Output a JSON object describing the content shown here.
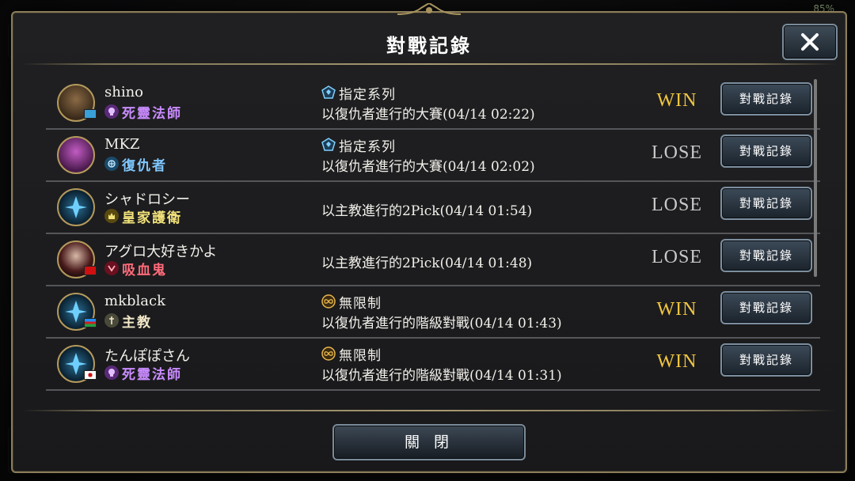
{
  "status": {
    "battery": "85%"
  },
  "dialog": {
    "title": "對戰記錄",
    "close_label": "關 閉",
    "row_button_label": "對戰記錄"
  },
  "rows": [
    {
      "name": "shino",
      "class": "死靈法師",
      "class_color": "#c98bff",
      "mode": "指定系列",
      "desc": "以復仇者進行的大賽(04/14 02:22)",
      "result": "WIN"
    },
    {
      "name": "MKZ",
      "class": "復仇者",
      "class_color": "#7fc8ff",
      "mode": "指定系列",
      "desc": "以復仇者進行的大賽(04/14 02:02)",
      "result": "LOSE"
    },
    {
      "name": "シャドロシー",
      "class": "皇家護衛",
      "class_color": "#f2e27a",
      "mode": "",
      "desc": "以主教進行的2Pick(04/14 01:54)",
      "result": "LOSE"
    },
    {
      "name": "アグロ大好きかよ",
      "class": "吸血鬼",
      "class_color": "#ff6a7a",
      "mode": "",
      "desc": "以主教進行的2Pick(04/14 01:48)",
      "result": "LOSE"
    },
    {
      "name": "mkblack",
      "class": "主教",
      "class_color": "#f2e8c8",
      "mode": "無限制",
      "desc": "以復仇者進行的階級對戰(04/14 01:43)",
      "result": "WIN"
    },
    {
      "name": "たんぽぽさん",
      "class": "死靈法師",
      "class_color": "#c98bff",
      "mode": "無限制",
      "desc": "以復仇者進行的階級對戰(04/14 01:31)",
      "result": "WIN"
    }
  ]
}
